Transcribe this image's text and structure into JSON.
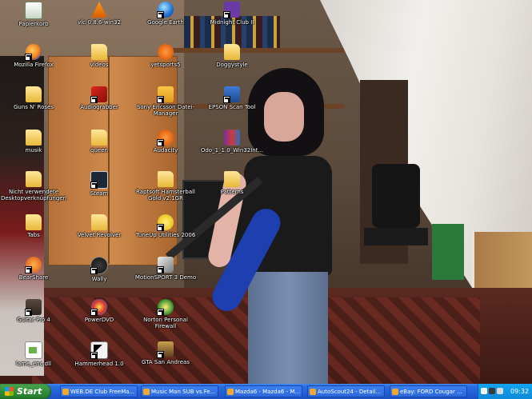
{
  "desktop": {
    "icons": [
      {
        "label": "Papierkorb",
        "icon": "recycle-bin-icon"
      },
      {
        "label": "vlc-0.8.6-win32",
        "icon": "vlc-cone-icon"
      },
      {
        "label": "Google Earth",
        "icon": "google-earth-icon"
      },
      {
        "label": "Midnight Club II",
        "icon": "game-icon"
      },
      {
        "label": "Mozilla Firefox",
        "icon": "firefox-icon"
      },
      {
        "label": "videos",
        "icon": "folder-icon"
      },
      {
        "label": "yetsports5",
        "icon": "firefox-html-icon"
      },
      {
        "label": "Doggystyle",
        "icon": "folder-icon"
      },
      {
        "label": "Guns N' Roses",
        "icon": "folder-icon"
      },
      {
        "label": "Audiograbber",
        "icon": "audiograbber-icon"
      },
      {
        "label": "Sony Ericsson Datei-Manager",
        "icon": "phone-manager-icon"
      },
      {
        "label": "EPSON Scan Tool",
        "icon": "scanner-icon"
      },
      {
        "label": "musik",
        "icon": "folder-icon"
      },
      {
        "label": "queen",
        "icon": "folder-icon"
      },
      {
        "label": "Audacity",
        "icon": "audacity-icon"
      },
      {
        "label": "Odo_1_1.0_Win32Int...",
        "icon": "winrar-archive-icon"
      },
      {
        "label": "Nicht verwendete Desktopverknüpfungen",
        "icon": "folder-icon"
      },
      {
        "label": "Steam",
        "icon": "steam-icon"
      },
      {
        "label": "Raptsoft Hamsterball Gold v2.1GR",
        "icon": "folder-icon"
      },
      {
        "label": "Patterns",
        "icon": "folder-icon"
      },
      {
        "label": "Tabs",
        "icon": "folder-icon"
      },
      {
        "label": "Velvet Revolver",
        "icon": "folder-icon"
      },
      {
        "label": "TuneUp Utilities 2006",
        "icon": "tuneup-icon"
      },
      {
        "label": "BearShare",
        "icon": "bearshare-icon"
      },
      {
        "label": "Wally",
        "icon": "wally-icon"
      },
      {
        "label": "MotionSPORT 3 Demo",
        "icon": "motion-demo-icon"
      },
      {
        "label": "Guitar Pro 4",
        "icon": "guitar-pro-icon"
      },
      {
        "label": "PowerDVD",
        "icon": "powerdvd-icon"
      },
      {
        "label": "Norton Personal Firewall",
        "icon": "norton-icon"
      },
      {
        "label": "lame_enc.dll",
        "icon": "dll-file-icon"
      },
      {
        "label": "Hammerhead 1.0",
        "icon": "hammerhead-icon"
      },
      {
        "label": "GTA San Andreas",
        "icon": "gta-icon"
      }
    ]
  },
  "taskbar": {
    "start_label": "Start",
    "tasks": [
      {
        "label": "WEB.DE Club FreeMa...",
        "icon": "browser-icon"
      },
      {
        "label": "Music Man SUB vs.Fe...",
        "icon": "browser-icon"
      },
      {
        "label": "Mazda6 - Mazda6 - M...",
        "icon": "browser-icon"
      },
      {
        "label": "AutoScout24 - Detail...",
        "icon": "browser-icon"
      },
      {
        "label": "eBay: FORD Cougar ...",
        "icon": "browser-icon"
      }
    ],
    "clock": "09:32"
  },
  "colors": {
    "taskbar_blue": "#245ed8",
    "start_green": "#2f8a37",
    "tray_blue": "#0b8ad8",
    "icon_label_text": "#ffffff"
  }
}
